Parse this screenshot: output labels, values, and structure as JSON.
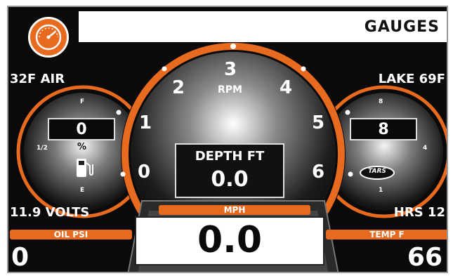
{
  "header": {
    "title": "GAUGES",
    "icon": "speedometer-icon"
  },
  "readouts": {
    "air": "32F AIR",
    "lake": "LAKE 69F",
    "volts": "11.9 VOLTS",
    "hrs": "HRS 12"
  },
  "rpm_gauge": {
    "label": "RPM",
    "ticks": [
      "0",
      "1",
      "2",
      "3",
      "4",
      "5",
      "6"
    ]
  },
  "fuel_gauge": {
    "value": "0",
    "unit": "%",
    "labels": {
      "full": "F",
      "half": "1/2",
      "empty": "E"
    },
    "icon": "fuel-pump-icon"
  },
  "trim_gauge": {
    "value": "8",
    "labels": {
      "top": "8",
      "mid": "4",
      "bottom": "1"
    },
    "logo": "TARS"
  },
  "depth": {
    "label": "DEPTH FT",
    "value": "0.0"
  },
  "speed": {
    "label": "MPH",
    "value": "0.0"
  },
  "oil": {
    "label": "OIL PSI",
    "value": "0"
  },
  "temp": {
    "label": "TEMP F",
    "value": "66"
  },
  "colors": {
    "accent": "#e86a1e",
    "background": "#0a0a0a",
    "text": "#ffffff"
  }
}
